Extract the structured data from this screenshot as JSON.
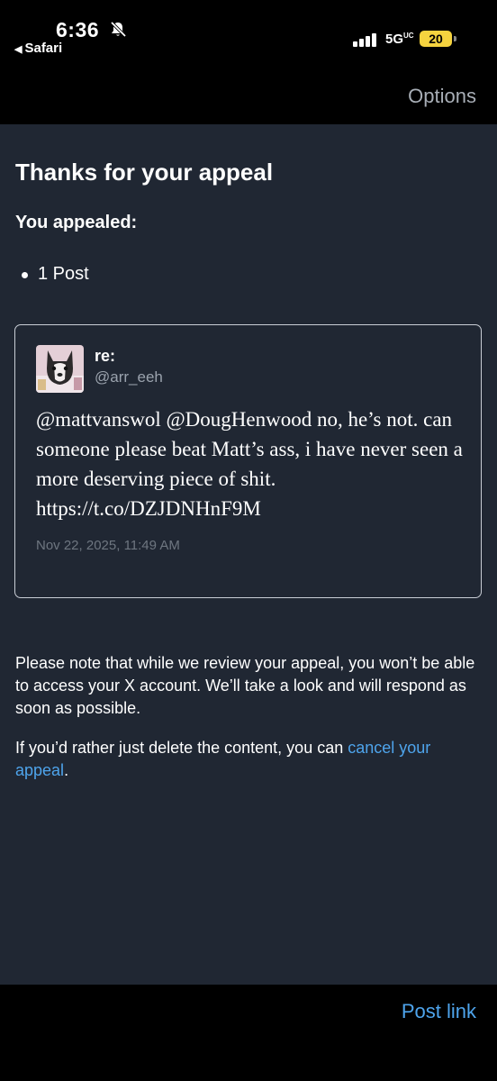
{
  "status_bar": {
    "time": "6:36",
    "back_app": "Safari",
    "network": "5G",
    "network_sub": "UC",
    "battery": "20"
  },
  "nav": {
    "options_label": "Options"
  },
  "appeal": {
    "title": "Thanks for your appeal",
    "subtitle": "You appealed:",
    "items": [
      "1 Post"
    ]
  },
  "post": {
    "author_name": "re:",
    "handle": "@arr_eeh",
    "text": "@mattvanswol @DougHenwood no, he’s not. can someone please beat Matt’s ass, i have never seen a more deserving piece of shit. https://t.co/DZJDNHnF9M",
    "date": "Nov 22, 2025, 11:49 AM"
  },
  "note": "Please note that while we review your appeal, you won’t be able to access your X account. We’ll take a look and will respond as soon as possible.",
  "cancel": {
    "prefix": "If you’d rather just delete the content, you can ",
    "link": "cancel your appeal",
    "suffix": "."
  },
  "bottom": {
    "post_link_label": "Post link"
  },
  "colors": {
    "background": "#202733",
    "link": "#4ea4ec",
    "battery": "#f5d33f"
  },
  "icons": [
    "bell-slash-icon",
    "back-triangle-icon",
    "cellular-signal-icon",
    "battery-icon"
  ]
}
